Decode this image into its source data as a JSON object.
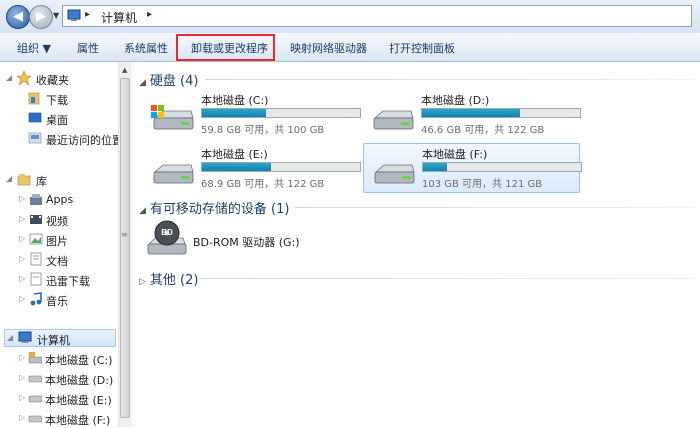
{
  "address": {
    "crumbs": [
      "计算机"
    ],
    "back_glyph": "◀",
    "forward_glyph": "▶"
  },
  "toolbar": {
    "organize": "组织 ▼",
    "properties": "属性",
    "system_properties": "系统属性",
    "uninstall": "卸载或更改程序",
    "map_drive": "映射网络驱动器",
    "control_panel": "打开控制面板"
  },
  "nav": {
    "favorites": {
      "label": "收藏夹",
      "items": [
        "下载",
        "桌面",
        "最近访问的位置"
      ]
    },
    "libraries": {
      "label": "库",
      "items": [
        "Apps",
        "视频",
        "图片",
        "文档",
        "迅雷下载",
        "音乐"
      ]
    },
    "computer": {
      "label": "计算机",
      "items": [
        "本地磁盘 (C:)",
        "本地磁盘 (D:)",
        "本地磁盘 (E:)",
        "本地磁盘 (F:)"
      ]
    }
  },
  "groups": {
    "hdd": "硬盘 (4)",
    "removable": "有可移动存储的设备 (1)",
    "other": "其他 (2)"
  },
  "drives": [
    {
      "name": "本地磁盘 (C:)",
      "free": "59.8 GB 可用，共 100 GB",
      "used_fraction": 0.402
    },
    {
      "name": "本地磁盘 (D:)",
      "free": "46.6 GB 可用，共 122 GB",
      "used_fraction": 0.618
    },
    {
      "name": "本地磁盘 (E:)",
      "free": "68.9 GB 可用，共 122 GB",
      "used_fraction": 0.435
    },
    {
      "name": "本地磁盘 (F:)",
      "free": "103 GB 可用，共 121 GB",
      "used_fraction": 0.149
    }
  ],
  "bdrom": {
    "name": "BD-ROM 驱动器 (G:)",
    "badge": "BD"
  },
  "colors": {
    "bar_fill": "#2a9ec6",
    "highlight": "#e52b30",
    "accent": "#1e3f6f"
  }
}
